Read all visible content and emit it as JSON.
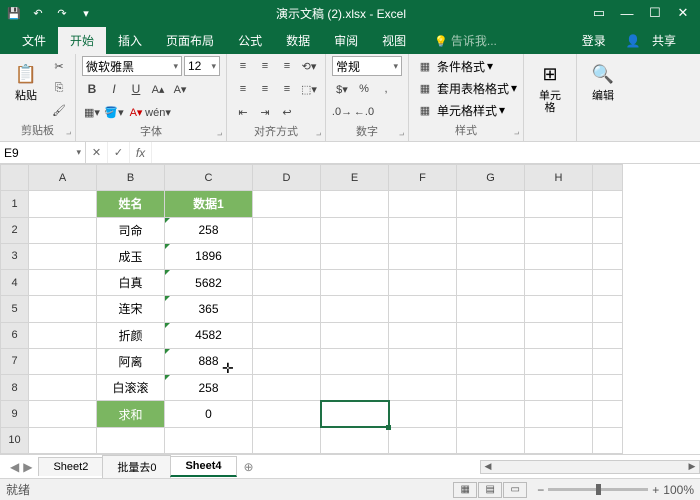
{
  "title": "演示文稿 (2).xlsx - Excel",
  "tabs": {
    "file": "文件",
    "home": "开始",
    "insert": "插入",
    "layout": "页面布局",
    "formulas": "公式",
    "data": "数据",
    "review": "审阅",
    "view": "视图",
    "tellme": "告诉我..."
  },
  "account": {
    "login": "登录",
    "share": "共享"
  },
  "ribbon": {
    "clipboard": {
      "paste": "粘贴",
      "label": "剪贴板"
    },
    "font": {
      "name": "微软雅黑",
      "size": "12",
      "label": "字体"
    },
    "align": {
      "label": "对齐方式"
    },
    "number": {
      "format": "常规",
      "label": "数字"
    },
    "styles": {
      "cond": "条件格式",
      "table": "套用表格格式",
      "cell": "单元格样式",
      "label": "样式"
    },
    "cells": {
      "label": "单元格"
    },
    "editing": {
      "label": "编辑"
    }
  },
  "namebox": "E9",
  "formula": "",
  "cols": [
    "A",
    "B",
    "C",
    "D",
    "E",
    "F",
    "G",
    "H",
    ""
  ],
  "rows": [
    "1",
    "2",
    "3",
    "4",
    "5",
    "6",
    "7",
    "8",
    "9",
    "10"
  ],
  "data": {
    "header": {
      "b": "姓名",
      "c": "数据1"
    },
    "r2": {
      "b": "司命",
      "c": "258"
    },
    "r3": {
      "b": "成玉",
      "c": "1896"
    },
    "r4": {
      "b": "白真",
      "c": "5682"
    },
    "r5": {
      "b": "连宋",
      "c": "365"
    },
    "r6": {
      "b": "折颜",
      "c": "4582"
    },
    "r7": {
      "b": "阿离",
      "c": "888"
    },
    "r8": {
      "b": "白滚滚",
      "c": "258"
    },
    "r9": {
      "b": "求和",
      "c": "0"
    }
  },
  "sheets": {
    "s1": "Sheet2",
    "s2": "批量去0",
    "s3": "Sheet4"
  },
  "status": {
    "ready": "就绪",
    "zoom": "100%"
  }
}
